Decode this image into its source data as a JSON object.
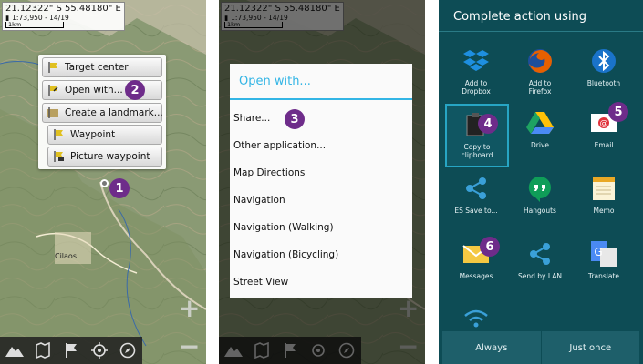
{
  "map": {
    "coords": "21.12322\" S 55.48180\" E",
    "scale_text": "1:73,950 - 14/19",
    "scale_bar_label": "1km",
    "place_labels": [
      "Cilaos"
    ]
  },
  "panel1": {
    "popup": {
      "items": [
        "Target center",
        "Open with...",
        "Create a landmark...",
        "Waypoint",
        "Picture waypoint"
      ]
    },
    "badges": [
      "1",
      "2"
    ]
  },
  "panel2": {
    "dialog_title": "Open with...",
    "items": [
      "Share...",
      "Other application...",
      "Map Directions",
      "Navigation",
      "Navigation (Walking)",
      "Navigation (Bicycling)",
      "Street View"
    ],
    "badges": [
      "3"
    ]
  },
  "panel3": {
    "title": "Complete action using",
    "apps": [
      {
        "label": "Add to\nDropbox",
        "icon": "dropbox-icon"
      },
      {
        "label": "Add to\nFirefox",
        "icon": "firefox-icon"
      },
      {
        "label": "Bluetooth",
        "icon": "bluetooth-icon"
      },
      {
        "label": "Copy to\nclipboard",
        "icon": "clipboard-icon"
      },
      {
        "label": "Drive",
        "icon": "drive-icon"
      },
      {
        "label": "Email",
        "icon": "email-icon"
      },
      {
        "label": "ES Save to...",
        "icon": "es-save-icon"
      },
      {
        "label": "Hangouts",
        "icon": "hangouts-icon"
      },
      {
        "label": "Memo",
        "icon": "memo-icon"
      },
      {
        "label": "Messages",
        "icon": "messages-icon"
      },
      {
        "label": "Send by LAN",
        "icon": "share-lan-icon"
      },
      {
        "label": "Translate",
        "icon": "translate-icon"
      },
      {
        "label": "",
        "icon": "wifi-direct-icon"
      }
    ],
    "buttons": {
      "always": "Always",
      "just_once": "Just once"
    },
    "badges": [
      "4",
      "5",
      "6"
    ]
  },
  "colors": {
    "badge": "#6e2c8a",
    "dialog_accent": "#33b5e5",
    "chooser_bg": "#0d4c55"
  }
}
